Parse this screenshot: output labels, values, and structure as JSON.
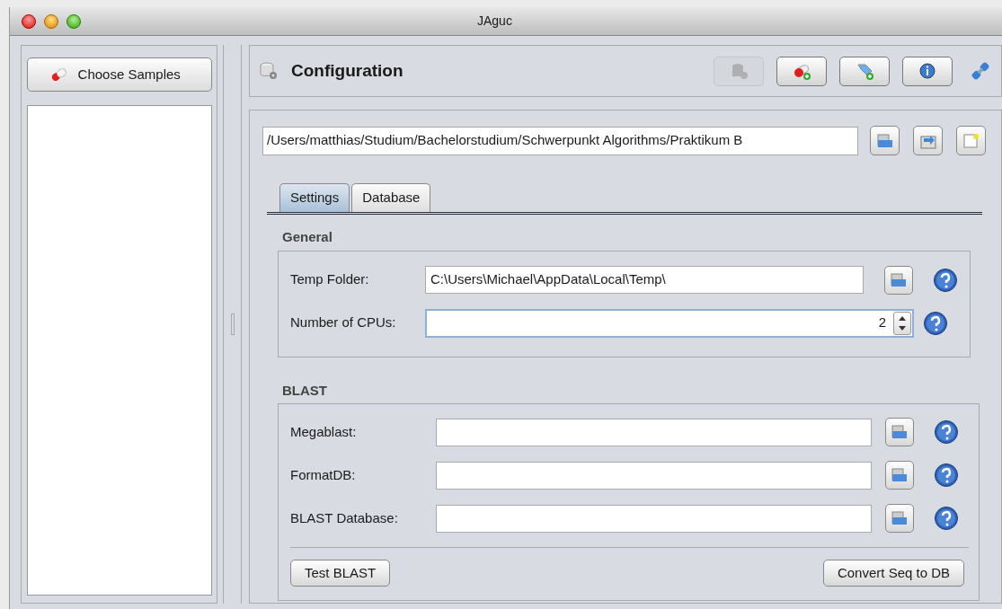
{
  "window": {
    "title": "JAguc"
  },
  "sidebar": {
    "button": "Choose Samples"
  },
  "header": {
    "title": "Configuration",
    "toolbar": [
      {
        "kind": "database",
        "disabled": true
      },
      {
        "kind": "pill-add",
        "disabled": false
      },
      {
        "kind": "tag-add",
        "disabled": false
      },
      {
        "kind": "info",
        "disabled": false
      }
    ]
  },
  "config_path": {
    "value": "/Users/matthias/Studium/Bachelorstudium/Schwerpunkt Algorithms/Praktikum B"
  },
  "tabs": [
    {
      "label": "Settings",
      "selected": true
    },
    {
      "label": "Database",
      "selected": false
    }
  ],
  "sections": [
    {
      "title": "General",
      "rows": [
        {
          "kind": "text",
          "label": "Temp Folder:",
          "value": "C:\\Users\\Michael\\AppData\\Local\\Temp\\"
        },
        {
          "kind": "spinner",
          "label": "Number of CPUs:",
          "value": "2"
        }
      ]
    },
    {
      "title": "BLAST",
      "rows": [
        {
          "kind": "text",
          "label": "Megablast:"
        },
        {
          "kind": "text",
          "label": "FormatDB:"
        },
        {
          "kind": "text",
          "label": "BLAST Database:"
        }
      ],
      "buttons": [
        "Test BLAST",
        "Convert Seq to DB"
      ]
    }
  ]
}
